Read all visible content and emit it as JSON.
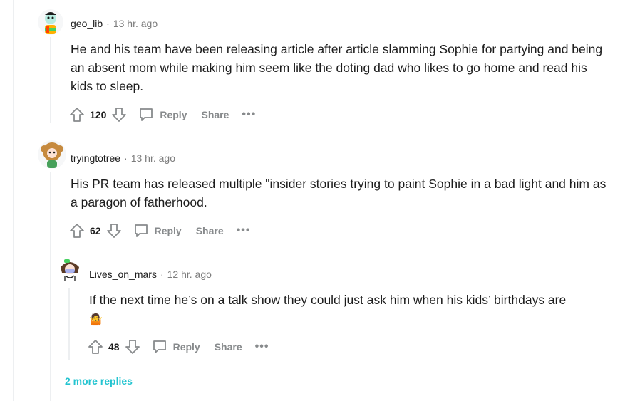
{
  "comments": [
    {
      "author": "geo_lib",
      "time": "13 hr. ago",
      "body": "He and his team have been releasing article after article slamming Sophie for partying and being an absent mom while making him seem like the doting dad who likes to go home and read his kids to sleep.",
      "votes": "120",
      "reply_label": "Reply",
      "share_label": "Share",
      "more_label": "•••"
    },
    {
      "author": "tryingtotree",
      "time": "13 hr. ago",
      "body": "His PR team has released multiple \"insider stories trying to paint Sophie in a bad light and him as a paragon of fatherhood.",
      "votes": "62",
      "reply_label": "Reply",
      "share_label": "Share",
      "more_label": "•••"
    },
    {
      "author": "Lives_on_mars",
      "time": "12 hr. ago",
      "body": "If the next time he’s on a talk show they could just ask him when his kids’ birthdays are",
      "emoji": "🤷",
      "votes": "48",
      "reply_label": "Reply",
      "share_label": "Share",
      "more_label": "•••"
    }
  ],
  "more_replies": "2 more replies",
  "colors": {
    "accent": "#24c4d0",
    "meta": "#7c7c7c",
    "actions": "#878a8c",
    "thread": "#edeff1"
  },
  "icons": [
    "upvote-icon",
    "downvote-icon",
    "reply-bubble-icon"
  ]
}
